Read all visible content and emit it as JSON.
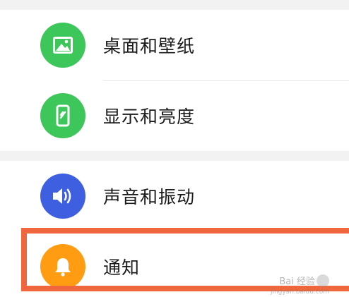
{
  "settings": {
    "items": [
      {
        "label": "桌面和壁纸",
        "icon": "image-icon",
        "color": "#3dc65a"
      },
      {
        "label": "显示和亮度",
        "icon": "phone-brightness-icon",
        "color": "#3dc65a"
      },
      {
        "label": "声音和振动",
        "icon": "speaker-icon",
        "color": "#3e5fe0"
      },
      {
        "label": "通知",
        "icon": "bell-icon",
        "color": "#ff9c12"
      }
    ]
  },
  "highlight_color": "#f0673d",
  "watermark": {
    "text": "Bai 经验",
    "sub": "jingyan.baidu.com"
  }
}
